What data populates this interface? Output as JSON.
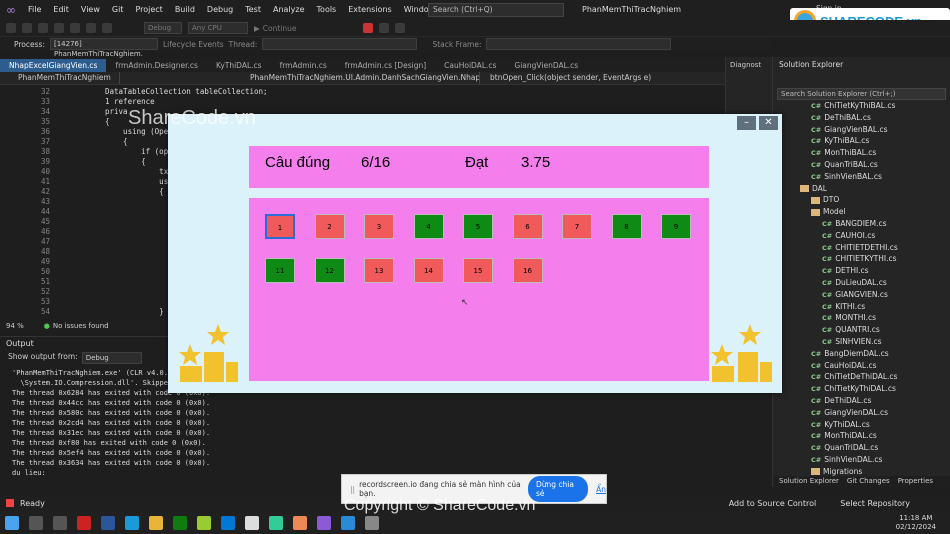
{
  "menubar": {
    "items": [
      "File",
      "Edit",
      "View",
      "Git",
      "Project",
      "Build",
      "Debug",
      "Test",
      "Analyze",
      "Tools",
      "Extensions",
      "Window",
      "Help"
    ],
    "search_placeholder": "Search (Ctrl+Q)",
    "app_title": "PhanMemThiTracNghiem",
    "sign_in": "Sign in"
  },
  "toolbar": {
    "config": "Debug",
    "platform": "Any CPU",
    "continue_label": "Continue",
    "process_label": "Process:",
    "process_value": "[14276] PhanMemThiTracNghiem.",
    "lifecycle_label": "Lifecycle Events",
    "thread_label": "Thread:",
    "stack_frame_label": "Stack Frame:"
  },
  "tabs": [
    {
      "label": "NhapExcelGiangVien.cs",
      "active": true
    },
    {
      "label": "frmAdmin.Designer.cs",
      "active": false
    },
    {
      "label": "KyThiDAL.cs",
      "active": false
    },
    {
      "label": "frmAdmin.cs",
      "active": false
    },
    {
      "label": "frmAdmin.cs [Design]",
      "active": false
    },
    {
      "label": "CauHoiDAL.cs",
      "active": false
    },
    {
      "label": "GiangVienDAL.cs",
      "active": false
    }
  ],
  "navbar": {
    "project": "PhanMemThiTracNghiem",
    "class": "PhanMemThiTracNghiem.UI.Admin.DanhSachGiangVien.NhapExc",
    "member": "btnOpen_Click(object sender, EventArgs e)"
  },
  "editor": {
    "lines": [
      {
        "no": "32",
        "code": "DataTableCollection tableCollection;"
      },
      {
        "no": "33",
        "code": "1 reference"
      },
      {
        "no": "34",
        "code": "priva"
      },
      {
        "no": "35",
        "code": "{"
      },
      {
        "no": "36",
        "code": "    using (Ope"
      },
      {
        "no": "37",
        "code": "    {"
      },
      {
        "no": "38",
        "code": "        if (op"
      },
      {
        "no": "39",
        "code": "        {"
      },
      {
        "no": "40",
        "code": "            tx"
      },
      {
        "no": "41",
        "code": "            us"
      },
      {
        "no": "42",
        "code": "            {"
      },
      {
        "no": "43",
        "code": ""
      },
      {
        "no": "44",
        "code": ""
      },
      {
        "no": "45",
        "code": ""
      },
      {
        "no": "46",
        "code": ""
      },
      {
        "no": "47",
        "code": ""
      },
      {
        "no": "48",
        "code": ""
      },
      {
        "no": "49",
        "code": ""
      },
      {
        "no": "50",
        "code": ""
      },
      {
        "no": "51",
        "code": ""
      },
      {
        "no": "52",
        "code": ""
      },
      {
        "no": "53",
        "code": ""
      },
      {
        "no": "54",
        "code": "            }"
      }
    ],
    "zoom": "94 %",
    "issues": "No issues found"
  },
  "output": {
    "title": "Output",
    "show_from_label": "Show output from:",
    "show_from_value": "Debug",
    "lines": [
      "'PhanMemThiTracNghiem.exe' (CLR v4.0.30",
      "  \\System.IO.Compression.dll'. Skipped l",
      "The thread 0x6284 has exited with code 0 (0x0).",
      "The thread 0x44cc has exited with code 0 (0x0).",
      "The thread 0x580c has exited with code 0 (0x0).",
      "The thread 0x2cd4 has exited with code 0 (0x0).",
      "The thread 0x31ec has exited with code 0 (0x0).",
      "The thread 0xf80 has exited with code 0 (0x0).",
      "The thread 0x5ef4 has exited with code 0 (0x0).",
      "The thread 0x3634 has exited with code 0 (0x0).",
      "du lieu:"
    ]
  },
  "solution_explorer": {
    "title": "Solution Explorer",
    "search_placeholder": "Search Solution Explorer (Ctrl+;)",
    "items": [
      {
        "label": "ChiTietKyThiBAL.cs",
        "kind": "cs",
        "indent": 2
      },
      {
        "label": "DeThiBAL.cs",
        "kind": "cs",
        "indent": 2
      },
      {
        "label": "GiangVienBAL.cs",
        "kind": "cs",
        "indent": 2
      },
      {
        "label": "KyThiBAL.cs",
        "kind": "cs",
        "indent": 2
      },
      {
        "label": "MonThiBAL.cs",
        "kind": "cs",
        "indent": 2
      },
      {
        "label": "QuanTriBAL.cs",
        "kind": "cs",
        "indent": 2
      },
      {
        "label": "SinhVienBAL.cs",
        "kind": "cs",
        "indent": 2
      },
      {
        "label": "DAL",
        "kind": "folder",
        "indent": 1
      },
      {
        "label": "DTO",
        "kind": "folder",
        "indent": 2
      },
      {
        "label": "Model",
        "kind": "folder",
        "indent": 2
      },
      {
        "label": "BANGDIEM.cs",
        "kind": "cs",
        "indent": 3
      },
      {
        "label": "CAUHOI.cs",
        "kind": "cs",
        "indent": 3
      },
      {
        "label": "CHITIETDETHI.cs",
        "kind": "cs",
        "indent": 3
      },
      {
        "label": "CHITIETKYTHI.cs",
        "kind": "cs",
        "indent": 3
      },
      {
        "label": "DETHI.cs",
        "kind": "cs",
        "indent": 3
      },
      {
        "label": "DuLieuDAL.cs",
        "kind": "cs",
        "indent": 3
      },
      {
        "label": "GIANGVIEN.cs",
        "kind": "cs",
        "indent": 3
      },
      {
        "label": "KITHI.cs",
        "kind": "cs",
        "indent": 3
      },
      {
        "label": "MONTHI.cs",
        "kind": "cs",
        "indent": 3
      },
      {
        "label": "QUANTRI.cs",
        "kind": "cs",
        "indent": 3
      },
      {
        "label": "SINHVIEN.cs",
        "kind": "cs",
        "indent": 3
      },
      {
        "label": "BangDiemDAL.cs",
        "kind": "cs",
        "indent": 2
      },
      {
        "label": "CauHoiDAL.cs",
        "kind": "cs",
        "indent": 2
      },
      {
        "label": "ChiTietDeThiDAL.cs",
        "kind": "cs",
        "indent": 2
      },
      {
        "label": "ChiTietKyThiDAL.cs",
        "kind": "cs",
        "indent": 2
      },
      {
        "label": "DeThiDAL.cs",
        "kind": "cs",
        "indent": 2
      },
      {
        "label": "GiangVienDAL.cs",
        "kind": "cs",
        "indent": 2
      },
      {
        "label": "KyThiDAL.cs",
        "kind": "cs",
        "indent": 2
      },
      {
        "label": "MonThiDAL.cs",
        "kind": "cs",
        "indent": 2
      },
      {
        "label": "QuanTriDAL.cs",
        "kind": "cs",
        "indent": 2
      },
      {
        "label": "SinhVienDAL.cs",
        "kind": "cs",
        "indent": 2
      },
      {
        "label": "Migrations",
        "kind": "folder",
        "indent": 2
      }
    ],
    "bottom_tabs": [
      "Solution Explorer",
      "Git Changes",
      "Properties"
    ]
  },
  "statusbar": {
    "ready": "Ready",
    "add_source": "Add to Source Control",
    "select_repo": "Select Repository"
  },
  "dialog": {
    "correct_label": "Câu đúng",
    "correct_value": "6/16",
    "score_label": "Đạt",
    "score_value": "3.75",
    "questions": [
      {
        "n": "1",
        "state": "red",
        "selected": true
      },
      {
        "n": "2",
        "state": "red",
        "selected": false
      },
      {
        "n": "3",
        "state": "red",
        "selected": false
      },
      {
        "n": "4",
        "state": "green",
        "selected": false
      },
      {
        "n": "5",
        "state": "green",
        "selected": false
      },
      {
        "n": "6",
        "state": "red",
        "selected": false
      },
      {
        "n": "7",
        "state": "red",
        "selected": false
      },
      {
        "n": "8",
        "state": "green",
        "selected": false
      },
      {
        "n": "9",
        "state": "green",
        "selected": false
      },
      {
        "n": "11",
        "state": "green",
        "selected": false
      },
      {
        "n": "12",
        "state": "green",
        "selected": false
      },
      {
        "n": "13",
        "state": "red",
        "selected": false
      },
      {
        "n": "14",
        "state": "red",
        "selected": false
      },
      {
        "n": "15",
        "state": "red",
        "selected": false
      },
      {
        "n": "16",
        "state": "red",
        "selected": false
      }
    ]
  },
  "screen_share": {
    "message": "recordscreen.io đang chia sẻ màn hình của bạn.",
    "stop_button": "Dừng chia sẻ",
    "hide_link": "Ẩn"
  },
  "taskbar": {
    "time": "11:18 AM",
    "date": "02/12/2024"
  },
  "watermark": {
    "top_left": "ShareCode.vn",
    "center": "Copyright © ShareCode.vn",
    "logo": "SHARECODE.vn"
  },
  "colors": {
    "wrong": "#f05a5a",
    "right": "#0f8a15",
    "panel": "#f47fec",
    "dialog_bg": "#dcf2fa"
  }
}
